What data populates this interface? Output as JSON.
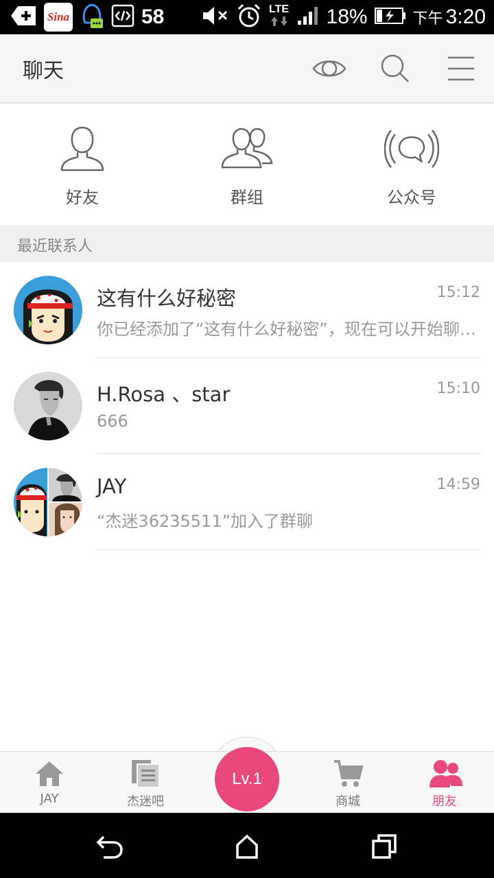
{
  "status_bar": {
    "sina_label": "Sina",
    "notification_count": "58",
    "network": "LTE",
    "battery": "18%",
    "ampm": "下午",
    "time": "3:20"
  },
  "header": {
    "title": "聊天"
  },
  "quick_tabs": [
    {
      "label": "好友",
      "icon": "person-icon"
    },
    {
      "label": "群组",
      "icon": "group-icon"
    },
    {
      "label": "公众号",
      "icon": "broadcast-icon"
    }
  ],
  "section": {
    "title": "最近联系人"
  },
  "conversations": [
    {
      "name": "这有什么好秘密",
      "preview": "你已经添加了“这有什么好秘密”，现在可以开始聊天了。",
      "time": "15:12"
    },
    {
      "name": "H.Rosa 、star",
      "preview": "666",
      "time": "15:10"
    },
    {
      "name": "JAY",
      "preview": "“杰迷36235511”加入了群聊",
      "time": "14:59"
    }
  ],
  "bottom_nav": {
    "items": [
      {
        "label": "JAY",
        "icon": "home-icon"
      },
      {
        "label": "杰迷吧",
        "icon": "document-icon"
      },
      {
        "label": "商城",
        "icon": "cart-icon"
      },
      {
        "label": "朋友",
        "icon": "friends-icon"
      }
    ],
    "center_label": "Lv.1",
    "active": "朋友"
  },
  "colors": {
    "accent": "#e9487d",
    "header_bg": "#f5f5f5",
    "section_bg": "#efefef"
  }
}
